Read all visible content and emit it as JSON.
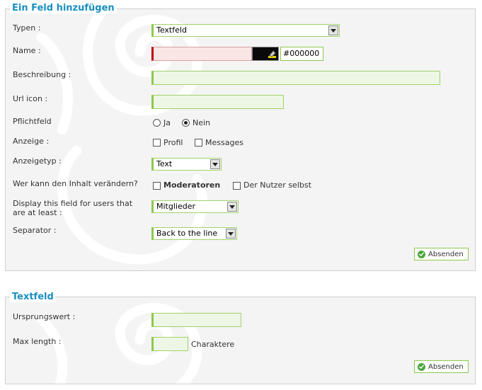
{
  "form1": {
    "legend": "Ein Feld hinzufügen",
    "typen": {
      "label": "Typen :",
      "value": "Textfeld"
    },
    "name": {
      "label": "Name :",
      "value": "",
      "color_hex": "#000000"
    },
    "beschreibung": {
      "label": "Beschreibung :",
      "value": ""
    },
    "url_icon": {
      "label": "Url icon :",
      "value": ""
    },
    "pflichtfeld": {
      "label": "Pflichtfeld",
      "options": [
        "Ja",
        "Nein"
      ],
      "selected": "Nein"
    },
    "anzeige": {
      "label": "Anzeige :",
      "options": [
        "Profil",
        "Messages"
      ]
    },
    "anzeigetyp": {
      "label": "Anzeigetyp :",
      "value": "Text"
    },
    "wer_kann": {
      "label": "Wer kann den Inhalt verändern?",
      "options": [
        "Moderatoren",
        "Der Nutzer selbst"
      ]
    },
    "display_for": {
      "label_line1": "Display this field for users that",
      "label_line2": "are at least :",
      "value": "Mitglieder"
    },
    "separator": {
      "label": "Separator :",
      "value": "Back to the line"
    },
    "submit": "Absenden"
  },
  "form2": {
    "legend": "Textfeld",
    "ursprungswert": {
      "label": "Ursprungswert :",
      "value": ""
    },
    "max_length": {
      "label": "Max length :",
      "value": "",
      "suffix": "Charaktere"
    },
    "submit": "Absenden"
  },
  "colors": {
    "legend": "#1a8fc0",
    "input_border": "#8cc84b",
    "input_bg": "#eef6e6",
    "error_marker": "#c00000",
    "panel_bg": "#f4f4f4"
  }
}
